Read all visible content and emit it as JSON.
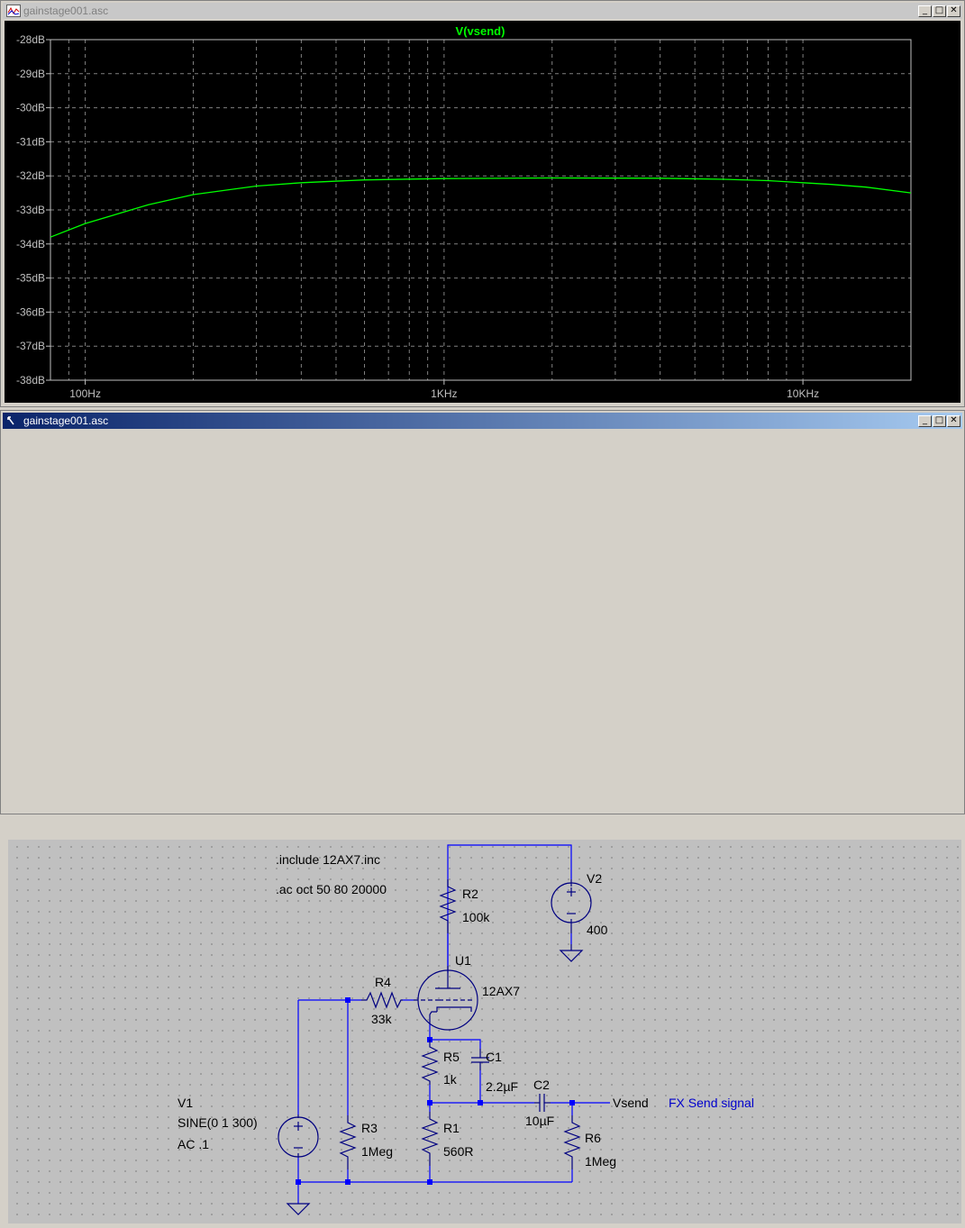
{
  "waveform_window": {
    "title": "gainstage001.asc",
    "trace_label": "V(vsend)",
    "trace_color": "#00ff00",
    "y_ticks": [
      "-28dB",
      "-29dB",
      "-30dB",
      "-31dB",
      "-32dB",
      "-33dB",
      "-34dB",
      "-35dB",
      "-36dB",
      "-37dB",
      "-38dB"
    ],
    "x_ticks": [
      "100Hz",
      "1KHz",
      "10KHz"
    ]
  },
  "chart_data": {
    "type": "line",
    "title": "",
    "xlabel": "",
    "ylabel": "",
    "x_scale": "log",
    "xlim": [
      80,
      20000
    ],
    "ylim": [
      -38,
      -28
    ],
    "grid": true,
    "series": [
      {
        "name": "V(vsend)",
        "x": [
          80,
          100,
          150,
          200,
          300,
          400,
          600,
          1000,
          2000,
          4000,
          6000,
          8000,
          10000,
          12000,
          15000,
          20000
        ],
        "y": [
          -33.8,
          -33.4,
          -32.85,
          -32.55,
          -32.3,
          -32.2,
          -32.12,
          -32.08,
          -32.06,
          -32.07,
          -32.1,
          -32.14,
          -32.2,
          -32.25,
          -32.33,
          -32.5
        ]
      }
    ]
  },
  "schematic_window": {
    "title": "gainstage001.asc",
    "directives": [
      ".include 12AX7.inc",
      ".ac oct 50 80 20000"
    ],
    "components": {
      "R2": {
        "name": "R2",
        "value": "100k"
      },
      "V2": {
        "name": "V2",
        "value": "400"
      },
      "U1": {
        "name": "U1",
        "value": "12AX7"
      },
      "R4": {
        "name": "R4",
        "value": "33k"
      },
      "R5": {
        "name": "R5",
        "value": "1k"
      },
      "C1": {
        "name": "C1",
        "value": "2.2µF"
      },
      "C2": {
        "name": "C2",
        "value": "10µF"
      },
      "V1": {
        "name": "V1",
        "value": "SINE(0 1 300)",
        "ac": "AC .1"
      },
      "R3": {
        "name": "R3",
        "value": "1Meg"
      },
      "R1": {
        "name": "R1",
        "value": "560R"
      },
      "R6": {
        "name": "R6",
        "value": "1Meg"
      }
    },
    "net_label": "Vsend",
    "comment": "FX Send signal",
    "wire_color": "#0000ff",
    "component_color": "#000080",
    "comment_color": "#0000cc"
  }
}
